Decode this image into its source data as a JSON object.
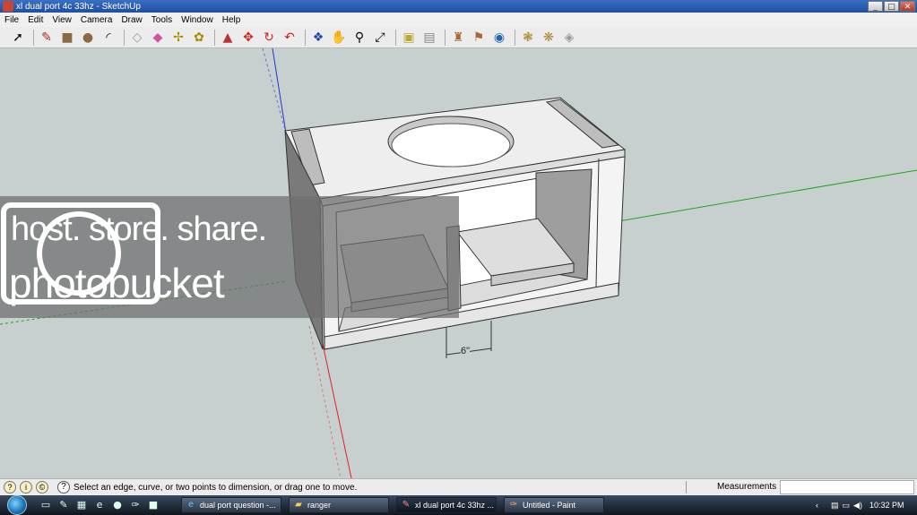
{
  "window": {
    "title": "xl dual port 4c 33hz - SketchUp",
    "buttons": [
      "_",
      "□",
      "✕"
    ]
  },
  "menu": [
    "File",
    "Edit",
    "View",
    "Camera",
    "Draw",
    "Tools",
    "Window",
    "Help"
  ],
  "toolbar": {
    "tools": [
      "select-tool-icon",
      "pencil-tool-icon",
      "rectangle-tool-icon",
      "circle-tool-icon",
      "arc-tool-icon",
      "eraser-tool-icon",
      "paint-tool-icon",
      "tape-measure-tool-icon",
      "rotate-tool-icon",
      "push-pull-tool-icon",
      "move-tool-icon",
      "rotate2-tool-icon",
      "follow-me-tool-icon",
      "orbit-tool-icon",
      "pan-tool-icon",
      "zoom-tool-icon",
      "zoom-extents-tool-icon",
      "get-models-icon",
      "share-model-icon",
      "components-icon",
      "dimension-tool-icon",
      "protractor-icon",
      "section-plane-icon",
      "walk-tool-icon",
      "layers-icon"
    ]
  },
  "model": {
    "dimension_label": "6\"",
    "axis_colors": {
      "red": "#d22",
      "green": "#1aa81a",
      "blue": "#2233cc"
    }
  },
  "watermark": {
    "line1": "host. store. share.",
    "line2": "photobucket"
  },
  "statusbar": {
    "message": "Select an edge, curve, or two points to dimension, or drag one to move.",
    "measurements_label": "Measurements"
  },
  "taskbar": {
    "tasks": [
      {
        "label": "dual port question -...",
        "active": false
      },
      {
        "label": "ranger",
        "active": false
      },
      {
        "label": "xl dual port 4c 33hz ...",
        "active": true
      },
      {
        "label": "Untitled - Paint",
        "active": false
      }
    ],
    "clock": "10:32 PM"
  }
}
